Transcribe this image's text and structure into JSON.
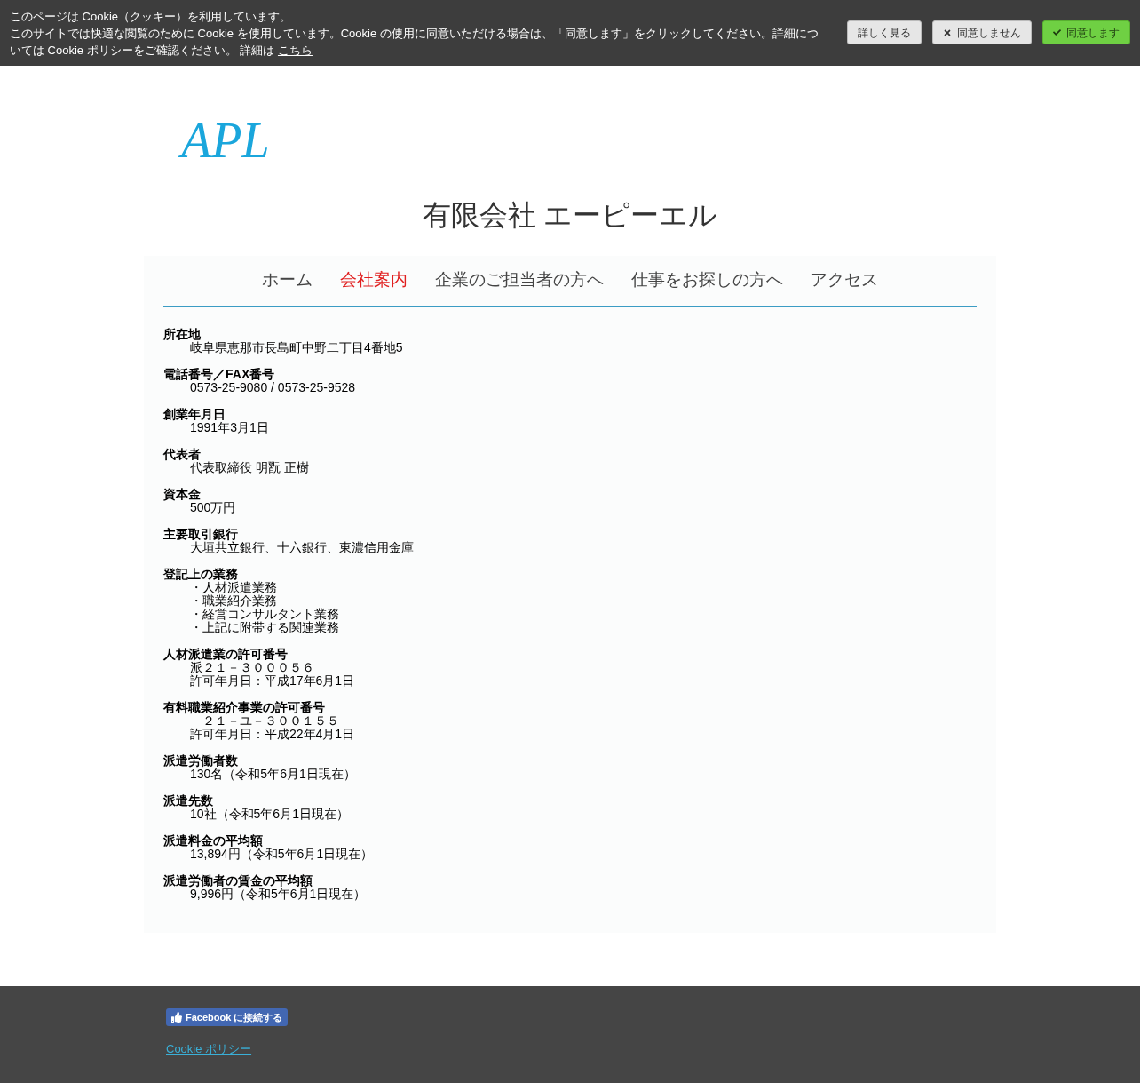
{
  "cookie_banner": {
    "title": "このページは Cookie（クッキー）を利用しています。",
    "message": "このサイトでは快適な閲覧のために Cookie を使用しています。Cookie の使用に同意いただける場合は、「同意します」をクリックしてください。詳細については Cookie ポリシーをご確認ください。 詳細は",
    "link": "こちら",
    "buttons": [
      {
        "label": "詳しく見る",
        "kind": "plain"
      },
      {
        "label": "同意しません",
        "kind": "decline"
      },
      {
        "label": "同意します",
        "kind": "accept"
      }
    ]
  },
  "logo": "APL",
  "site_title": "有限会社 エーピーエル",
  "nav": [
    {
      "label": "ホーム",
      "selected": false
    },
    {
      "label": "会社案内",
      "selected": true
    },
    {
      "label": "企業のご担当者の方へ",
      "selected": false
    },
    {
      "label": "仕事をお探しの方へ",
      "selected": false
    },
    {
      "label": "アクセス",
      "selected": false
    }
  ],
  "details": [
    {
      "term": "所在地",
      "lines": [
        "岐阜県恵那市長島町中野二丁目4番地5"
      ]
    },
    {
      "term": "電話番号／FAX番号",
      "lines": [
        "0573-25-9080 / 0573-25-9528"
      ]
    },
    {
      "term": "創業年月日",
      "lines": [
        "1991年3月1日"
      ]
    },
    {
      "term": "代表者",
      "lines": [
        "代表取締役 明翫 正樹"
      ]
    },
    {
      "term": "資本金",
      "lines": [
        "500万円"
      ]
    },
    {
      "term": "主要取引銀行",
      "lines": [
        "大垣共立銀行、十六銀行、東濃信用金庫"
      ]
    },
    {
      "term": "登記上の業務",
      "lines": [
        "・人材派遣業務",
        "・職業紹介業務",
        "・経営コンサルタント業務",
        "・上記に附帯する関連業務"
      ]
    },
    {
      "term": "人材派遣業の許可番号",
      "lines": [
        "派２１－３０００５６",
        "許可年月日：平成17年6月1日"
      ]
    },
    {
      "term": "有料職業紹介事業の許可番号",
      "lines": [
        "　２１－ユ－３００１５５",
        "許可年月日：平成22年4月1日"
      ]
    },
    {
      "term": "派遣労働者数",
      "lines": [
        "130名（令和5年6月1日現在）"
      ]
    },
    {
      "term": "派遣先数",
      "lines": [
        "10社（令和5年6月1日現在）"
      ]
    },
    {
      "term": "派遣料金の平均額",
      "lines": [
        "13,894円（令和5年6月1日現在）"
      ]
    },
    {
      "term": "派遣労働者の賃金の平均額",
      "lines": [
        "9,996円（令和5年6月1日現在）"
      ]
    }
  ],
  "footer": {
    "facebook_button": "Facebook に接続する",
    "cookie_link": "Cookie ポリシー"
  }
}
